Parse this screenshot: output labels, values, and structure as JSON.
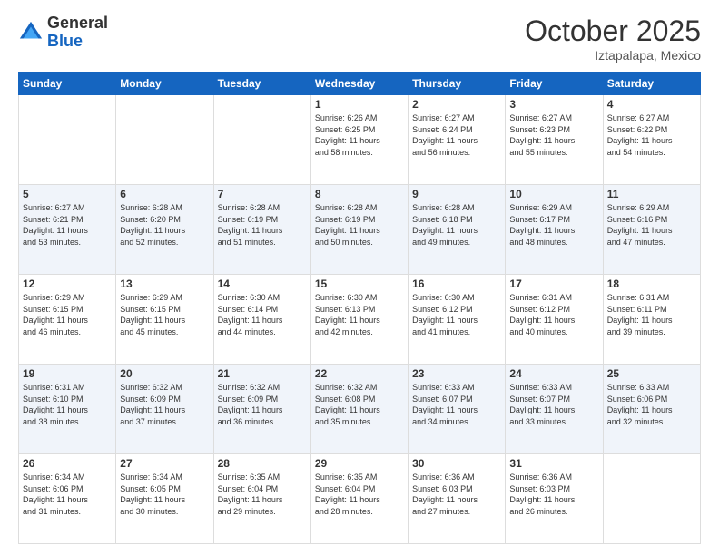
{
  "header": {
    "logo": {
      "text_general": "General",
      "text_blue": "Blue"
    },
    "title": "October 2025",
    "subtitle": "Iztapalapa, Mexico"
  },
  "days_of_week": [
    "Sunday",
    "Monday",
    "Tuesday",
    "Wednesday",
    "Thursday",
    "Friday",
    "Saturday"
  ],
  "weeks": [
    [
      {
        "day": "",
        "info": ""
      },
      {
        "day": "",
        "info": ""
      },
      {
        "day": "",
        "info": ""
      },
      {
        "day": "1",
        "info": "Sunrise: 6:26 AM\nSunset: 6:25 PM\nDaylight: 11 hours\nand 58 minutes."
      },
      {
        "day": "2",
        "info": "Sunrise: 6:27 AM\nSunset: 6:24 PM\nDaylight: 11 hours\nand 56 minutes."
      },
      {
        "day": "3",
        "info": "Sunrise: 6:27 AM\nSunset: 6:23 PM\nDaylight: 11 hours\nand 55 minutes."
      },
      {
        "day": "4",
        "info": "Sunrise: 6:27 AM\nSunset: 6:22 PM\nDaylight: 11 hours\nand 54 minutes."
      }
    ],
    [
      {
        "day": "5",
        "info": "Sunrise: 6:27 AM\nSunset: 6:21 PM\nDaylight: 11 hours\nand 53 minutes."
      },
      {
        "day": "6",
        "info": "Sunrise: 6:28 AM\nSunset: 6:20 PM\nDaylight: 11 hours\nand 52 minutes."
      },
      {
        "day": "7",
        "info": "Sunrise: 6:28 AM\nSunset: 6:19 PM\nDaylight: 11 hours\nand 51 minutes."
      },
      {
        "day": "8",
        "info": "Sunrise: 6:28 AM\nSunset: 6:19 PM\nDaylight: 11 hours\nand 50 minutes."
      },
      {
        "day": "9",
        "info": "Sunrise: 6:28 AM\nSunset: 6:18 PM\nDaylight: 11 hours\nand 49 minutes."
      },
      {
        "day": "10",
        "info": "Sunrise: 6:29 AM\nSunset: 6:17 PM\nDaylight: 11 hours\nand 48 minutes."
      },
      {
        "day": "11",
        "info": "Sunrise: 6:29 AM\nSunset: 6:16 PM\nDaylight: 11 hours\nand 47 minutes."
      }
    ],
    [
      {
        "day": "12",
        "info": "Sunrise: 6:29 AM\nSunset: 6:15 PM\nDaylight: 11 hours\nand 46 minutes."
      },
      {
        "day": "13",
        "info": "Sunrise: 6:29 AM\nSunset: 6:15 PM\nDaylight: 11 hours\nand 45 minutes."
      },
      {
        "day": "14",
        "info": "Sunrise: 6:30 AM\nSunset: 6:14 PM\nDaylight: 11 hours\nand 44 minutes."
      },
      {
        "day": "15",
        "info": "Sunrise: 6:30 AM\nSunset: 6:13 PM\nDaylight: 11 hours\nand 42 minutes."
      },
      {
        "day": "16",
        "info": "Sunrise: 6:30 AM\nSunset: 6:12 PM\nDaylight: 11 hours\nand 41 minutes."
      },
      {
        "day": "17",
        "info": "Sunrise: 6:31 AM\nSunset: 6:12 PM\nDaylight: 11 hours\nand 40 minutes."
      },
      {
        "day": "18",
        "info": "Sunrise: 6:31 AM\nSunset: 6:11 PM\nDaylight: 11 hours\nand 39 minutes."
      }
    ],
    [
      {
        "day": "19",
        "info": "Sunrise: 6:31 AM\nSunset: 6:10 PM\nDaylight: 11 hours\nand 38 minutes."
      },
      {
        "day": "20",
        "info": "Sunrise: 6:32 AM\nSunset: 6:09 PM\nDaylight: 11 hours\nand 37 minutes."
      },
      {
        "day": "21",
        "info": "Sunrise: 6:32 AM\nSunset: 6:09 PM\nDaylight: 11 hours\nand 36 minutes."
      },
      {
        "day": "22",
        "info": "Sunrise: 6:32 AM\nSunset: 6:08 PM\nDaylight: 11 hours\nand 35 minutes."
      },
      {
        "day": "23",
        "info": "Sunrise: 6:33 AM\nSunset: 6:07 PM\nDaylight: 11 hours\nand 34 minutes."
      },
      {
        "day": "24",
        "info": "Sunrise: 6:33 AM\nSunset: 6:07 PM\nDaylight: 11 hours\nand 33 minutes."
      },
      {
        "day": "25",
        "info": "Sunrise: 6:33 AM\nSunset: 6:06 PM\nDaylight: 11 hours\nand 32 minutes."
      }
    ],
    [
      {
        "day": "26",
        "info": "Sunrise: 6:34 AM\nSunset: 6:06 PM\nDaylight: 11 hours\nand 31 minutes."
      },
      {
        "day": "27",
        "info": "Sunrise: 6:34 AM\nSunset: 6:05 PM\nDaylight: 11 hours\nand 30 minutes."
      },
      {
        "day": "28",
        "info": "Sunrise: 6:35 AM\nSunset: 6:04 PM\nDaylight: 11 hours\nand 29 minutes."
      },
      {
        "day": "29",
        "info": "Sunrise: 6:35 AM\nSunset: 6:04 PM\nDaylight: 11 hours\nand 28 minutes."
      },
      {
        "day": "30",
        "info": "Sunrise: 6:36 AM\nSunset: 6:03 PM\nDaylight: 11 hours\nand 27 minutes."
      },
      {
        "day": "31",
        "info": "Sunrise: 6:36 AM\nSunset: 6:03 PM\nDaylight: 11 hours\nand 26 minutes."
      },
      {
        "day": "",
        "info": ""
      }
    ]
  ]
}
